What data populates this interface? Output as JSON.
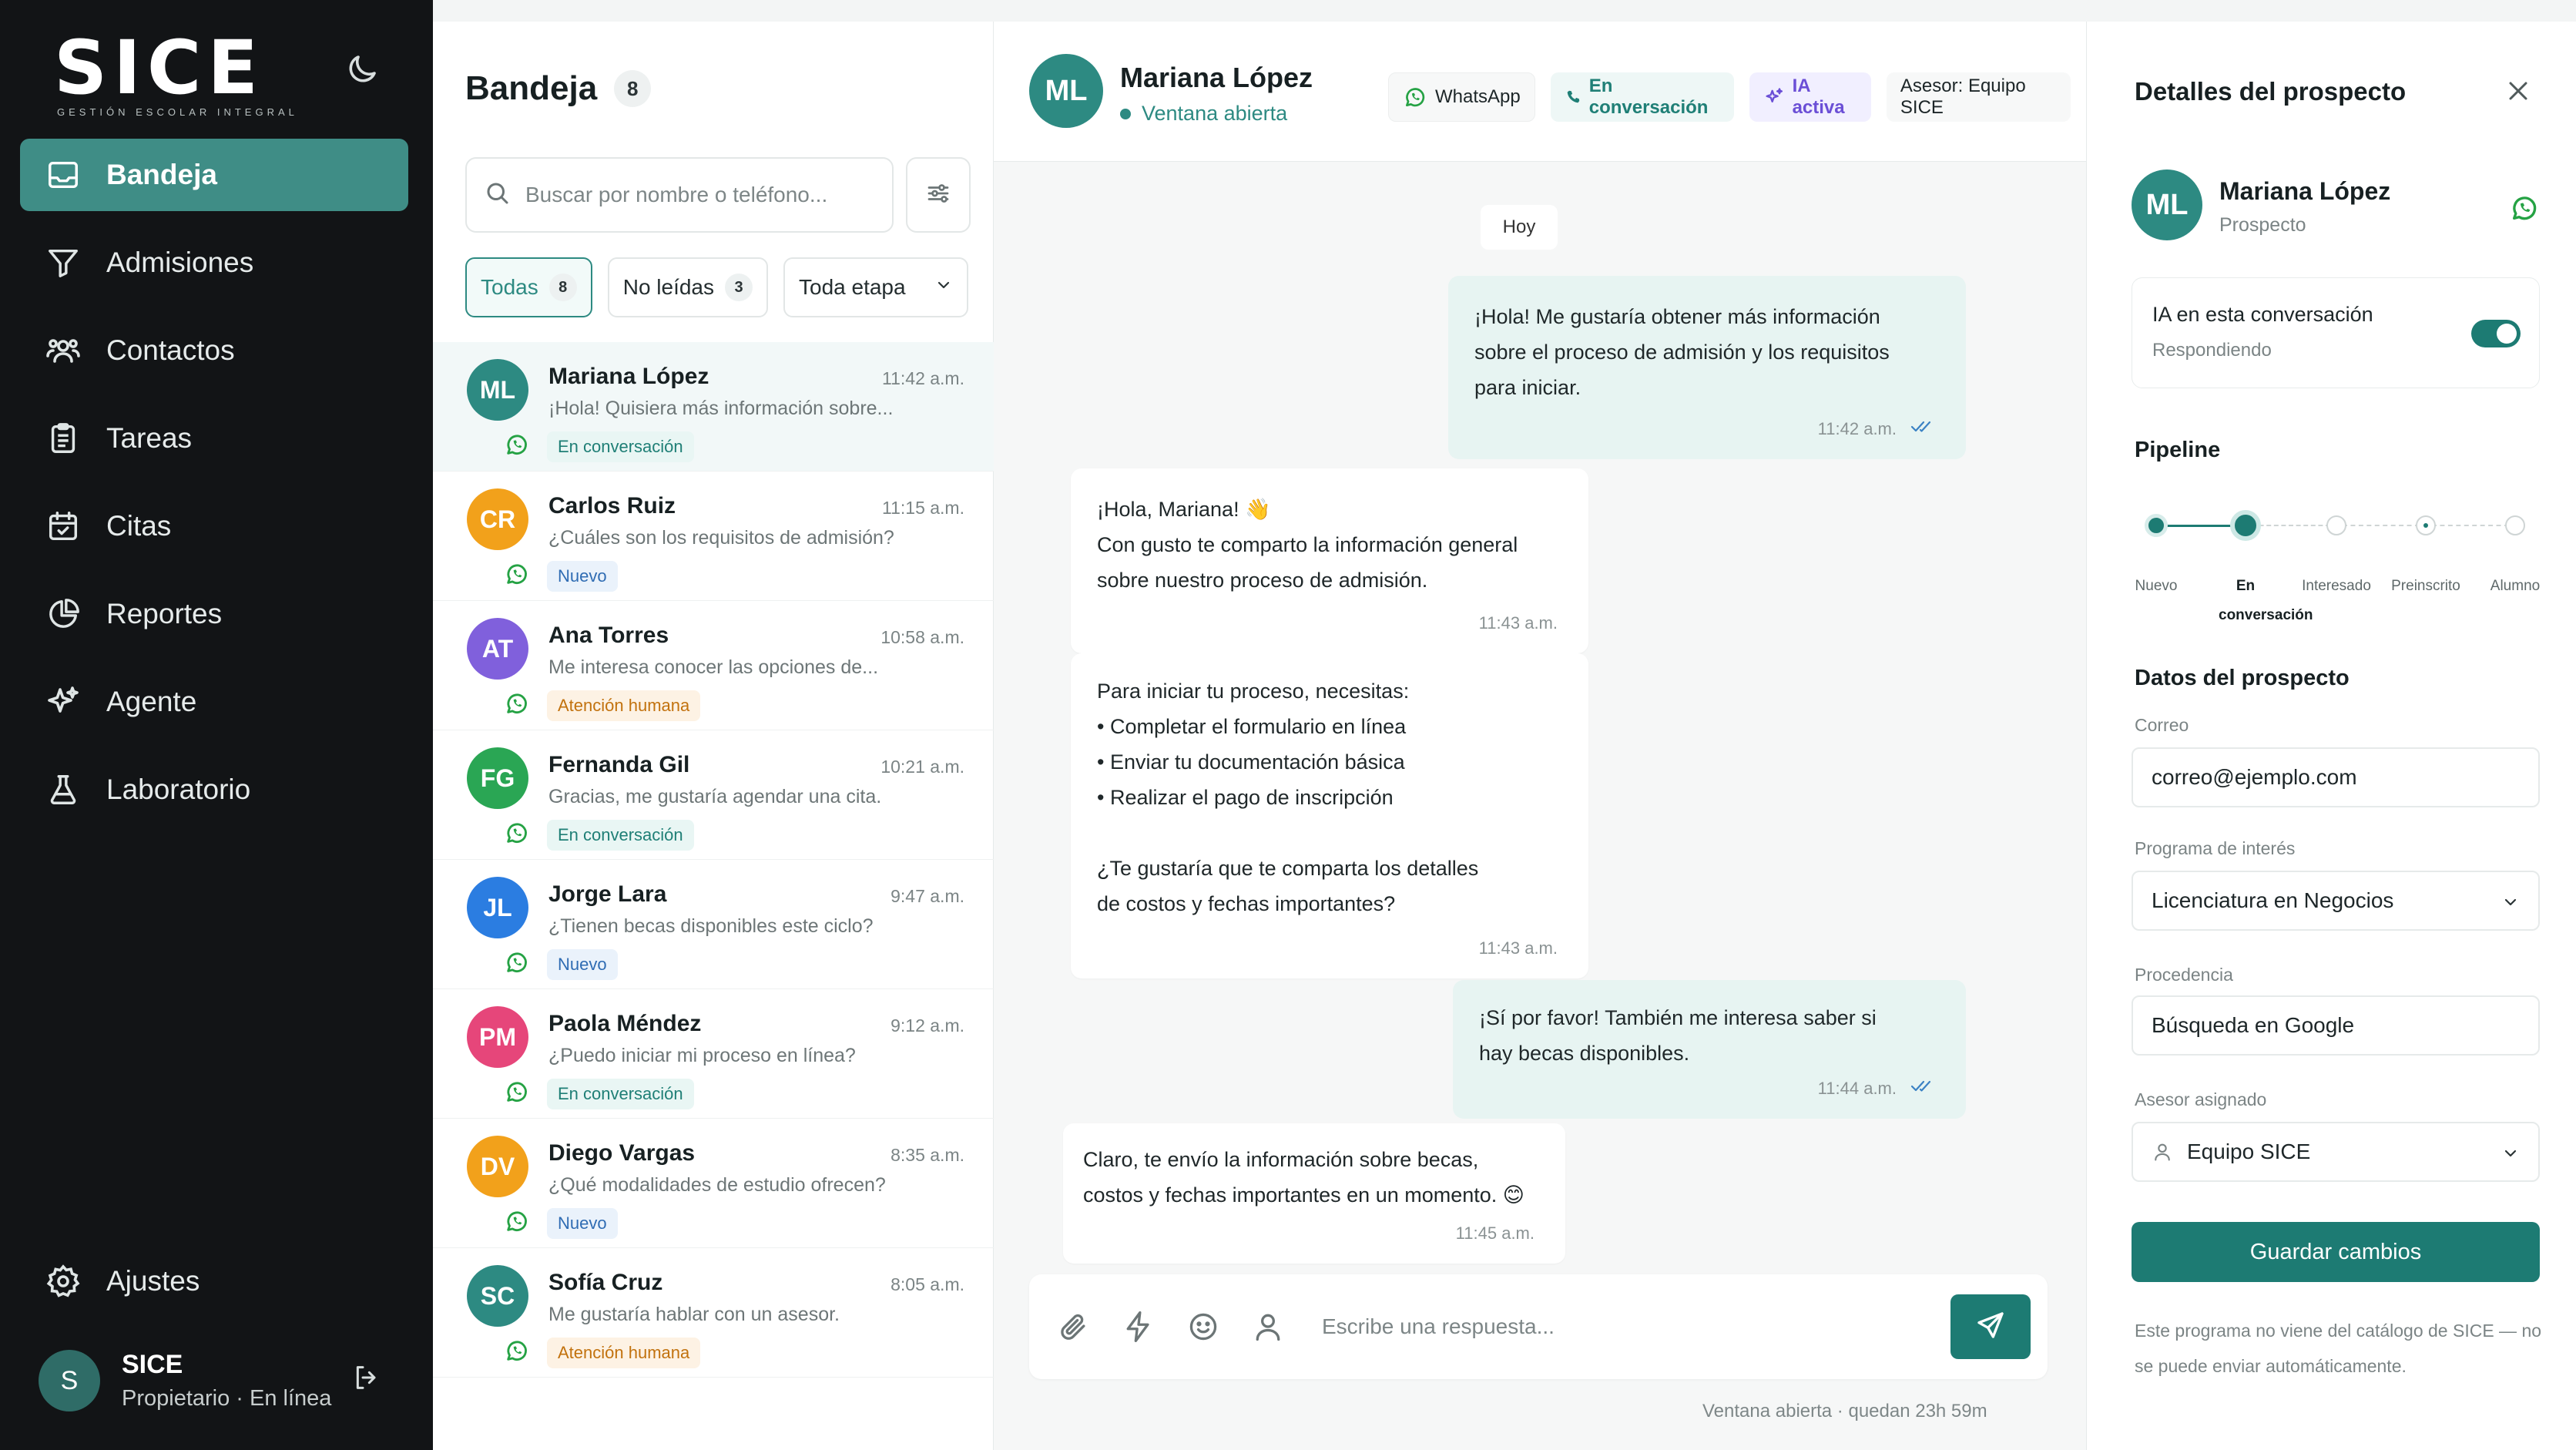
{
  "brand": {
    "logo": "SICE",
    "subtitle": "GESTIÓN ESCOLAR INTEGRAL"
  },
  "nav": [
    {
      "label": "Bandeja",
      "icon": "inbox-icon",
      "active": true
    },
    {
      "label": "Admisiones",
      "icon": "funnel-icon"
    },
    {
      "label": "Contactos",
      "icon": "contacts-icon"
    },
    {
      "label": "Tareas",
      "icon": "clipboard-icon"
    },
    {
      "label": "Citas",
      "icon": "calendar-icon"
    },
    {
      "label": "Reportes",
      "icon": "pie-chart-icon"
    },
    {
      "label": "Agente",
      "icon": "sparkle-icon"
    },
    {
      "label": "Laboratorio",
      "icon": "flask-icon"
    }
  ],
  "settings": {
    "label": "Ajustes"
  },
  "user": {
    "initial": "S",
    "name": "SICE",
    "role": "Propietario · En línea"
  },
  "inbox": {
    "title": "Bandeja",
    "count": "8",
    "search_placeholder": "Buscar por nombre o teléfono...",
    "filters": {
      "all": "Todas",
      "all_count": "8",
      "unread": "No leídas",
      "unread_count": "3",
      "stage": "Toda etapa"
    },
    "conversations": [
      {
        "initials": "ML",
        "color": "#2d8a82",
        "name": "Mariana López",
        "time": "11:42 a.m.",
        "preview": "¡Hola! Quisiera más información sobre...",
        "status": "En conversación",
        "status_type": "conv"
      },
      {
        "initials": "CR",
        "color": "#f2a11b",
        "name": "Carlos Ruiz",
        "time": "11:15 a.m.",
        "preview": "¿Cuáles son los requisitos de admisión?",
        "status": "Nuevo",
        "status_type": "new"
      },
      {
        "initials": "AT",
        "color": "#8060dc",
        "name": "Ana Torres",
        "time": "10:58 a.m.",
        "preview": "Me interesa conocer las opciones de...",
        "status": "Atención humana",
        "status_type": "hum"
      },
      {
        "initials": "FG",
        "color": "#2aa654",
        "name": "Fernanda Gil",
        "time": "10:21 a.m.",
        "preview": "Gracias, me gustaría agendar una cita.",
        "status": "En conversación",
        "status_type": "conv"
      },
      {
        "initials": "JL",
        "color": "#2b7de1",
        "name": "Jorge Lara",
        "time": "9:47 a.m.",
        "preview": "¿Tienen becas disponibles este ciclo?",
        "status": "Nuevo",
        "status_type": "new"
      },
      {
        "initials": "PM",
        "color": "#e6467a",
        "name": "Paola Méndez",
        "time": "9:12 a.m.",
        "preview": "¿Puedo iniciar mi proceso en línea?",
        "status": "En conversación",
        "status_type": "conv"
      },
      {
        "initials": "DV",
        "color": "#f2a11b",
        "name": "Diego Vargas",
        "time": "8:35 a.m.",
        "preview": "¿Qué modalidades de estudio ofrecen?",
        "status": "Nuevo",
        "status_type": "new"
      },
      {
        "initials": "SC",
        "color": "#2d8a82",
        "name": "Sofía Cruz",
        "time": "8:05 a.m.",
        "preview": "Me gustaría hablar con un asesor.",
        "status": "Atención humana",
        "status_type": "hum"
      }
    ]
  },
  "chat": {
    "initials": "ML",
    "name": "Mariana López",
    "status": "Ventana abierta",
    "tags": {
      "channel": "WhatsApp",
      "stage": "En conversación",
      "ai": "IA activa",
      "advisor": "Asesor: Equipo SICE"
    },
    "day": "Hoy",
    "messages": [
      {
        "dir": "out",
        "lines": [
          "¡Hola! Me gustaría obtener más información",
          "sobre el proceso de admisión y los requisitos",
          "para iniciar."
        ],
        "time": "11:42 a.m."
      },
      {
        "dir": "in",
        "lines": [
          "¡Hola, Mariana! 👋",
          "Con gusto te comparto la información general",
          "sobre nuestro proceso de admisión."
        ],
        "time": "11:43 a.m."
      },
      {
        "dir": "in",
        "lines": [
          "Para iniciar tu proceso, necesitas:",
          "• Completar el formulario en línea",
          "• Enviar tu documentación básica",
          "• Realizar el pago de inscripción",
          "",
          "¿Te gustaría que te comparta los detalles",
          "de costos y fechas importantes?"
        ],
        "time": "11:43 a.m."
      },
      {
        "dir": "out",
        "lines": [
          "¡Sí por favor! También me interesa saber si",
          "hay becas disponibles."
        ],
        "time": "11:44 a.m."
      },
      {
        "dir": "in",
        "lines": [
          "Claro, te envío la información sobre becas,",
          "costos y fechas importantes en un momento. 😊"
        ],
        "time": "11:45 a.m."
      }
    ],
    "composer_placeholder": "Escribe una respuesta...",
    "window_note": "Ventana abierta · quedan 23h 59m"
  },
  "details": {
    "title": "Detalles del prospecto",
    "prospect": {
      "initials": "ML",
      "name": "Mariana López",
      "role": "Prospecto"
    },
    "ai": {
      "title": "IA en esta conversación",
      "subtitle": "Respondiendo",
      "enabled": true
    },
    "pipeline_title": "Pipeline",
    "pipeline": [
      {
        "label": "Nuevo",
        "state": "done"
      },
      {
        "label": "En conversación",
        "state": "current"
      },
      {
        "label": "Interesado",
        "state": "todo"
      },
      {
        "label": "Preinscrito",
        "state": "todo"
      },
      {
        "label": "Alumno",
        "state": "todo"
      }
    ],
    "data_title": "Datos del prospecto",
    "email_label": "Correo",
    "email": "correo@ejemplo.com",
    "program_label": "Programa de interés",
    "program": "Licenciatura en Negocios",
    "origin_label": "Procedencia",
    "origin": "Búsqueda en Google",
    "advisor_label": "Asesor asignado",
    "advisor": "Equipo SICE",
    "save": "Guardar cambios",
    "note": "Este programa no viene del catálogo de SICE — no se puede enviar automáticamente."
  },
  "colors": {
    "accent": "#1d7b73",
    "accent_light": "#3f8d86",
    "sidebar_bg": "#121416"
  }
}
